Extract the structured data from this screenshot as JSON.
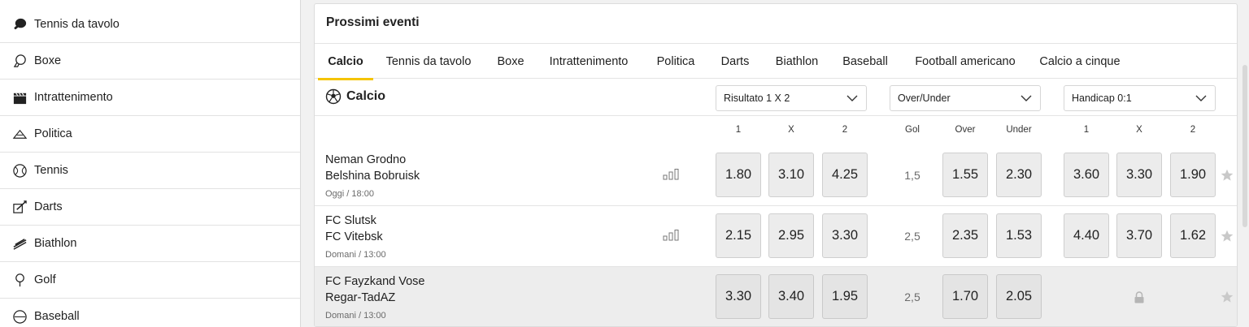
{
  "sidebar": {
    "items": [
      {
        "label": "Tennis da tavolo",
        "icon": "table-tennis-icon"
      },
      {
        "label": "Boxe",
        "icon": "boxing-glove-icon"
      },
      {
        "label": "Intrattenimento",
        "icon": "clapperboard-icon"
      },
      {
        "label": "Politica",
        "icon": "politics-icon"
      },
      {
        "label": "Tennis",
        "icon": "tennis-ball-icon"
      },
      {
        "label": "Darts",
        "icon": "darts-icon"
      },
      {
        "label": "Biathlon",
        "icon": "biathlon-icon"
      },
      {
        "label": "Golf",
        "icon": "golf-icon"
      },
      {
        "label": "Baseball",
        "icon": "baseball-icon"
      }
    ]
  },
  "main": {
    "title": "Prossimi eventi",
    "tabs": [
      "Calcio",
      "Tennis da tavolo",
      "Boxe",
      "Intrattenimento",
      "Politica",
      "Darts",
      "Biathlon",
      "Baseball",
      "Football americano",
      "Calcio a cinque"
    ],
    "active_tab": "Calcio",
    "section_title": "Calcio",
    "dropdowns": [
      "Risultato 1 X 2",
      "Over/Under",
      "Handicap 0:1"
    ],
    "columns": [
      "1",
      "X",
      "2",
      "Gol",
      "Over",
      "Under",
      "1",
      "X",
      "2"
    ]
  },
  "matches": [
    {
      "home": "Neman Grodno",
      "away": "Belshina Bobruisk",
      "time": "Oggi / 18:00",
      "odds_1x2": [
        "1.80",
        "3.10",
        "4.25"
      ],
      "gol": "1,5",
      "over": "1.55",
      "under": "2.30",
      "handicap": [
        "3.60",
        "3.30",
        "1.90"
      ],
      "locked": false
    },
    {
      "home": "FC Slutsk",
      "away": "FC Vitebsk",
      "time": "Domani / 13:00",
      "odds_1x2": [
        "2.15",
        "2.95",
        "3.30"
      ],
      "gol": "2,5",
      "over": "2.35",
      "under": "1.53",
      "handicap": [
        "4.40",
        "3.70",
        "1.62"
      ],
      "locked": false
    },
    {
      "home": "FC Fayzkand Vose",
      "away": "Regar-TadAZ",
      "time": "Domani / 13:00",
      "odds_1x2": [
        "3.30",
        "3.40",
        "1.95"
      ],
      "gol": "2,5",
      "over": "1.70",
      "under": "2.05",
      "handicap": [],
      "locked": true
    }
  ],
  "colors": {
    "accent": "#f5c400",
    "row_highlight": "#ededed"
  }
}
